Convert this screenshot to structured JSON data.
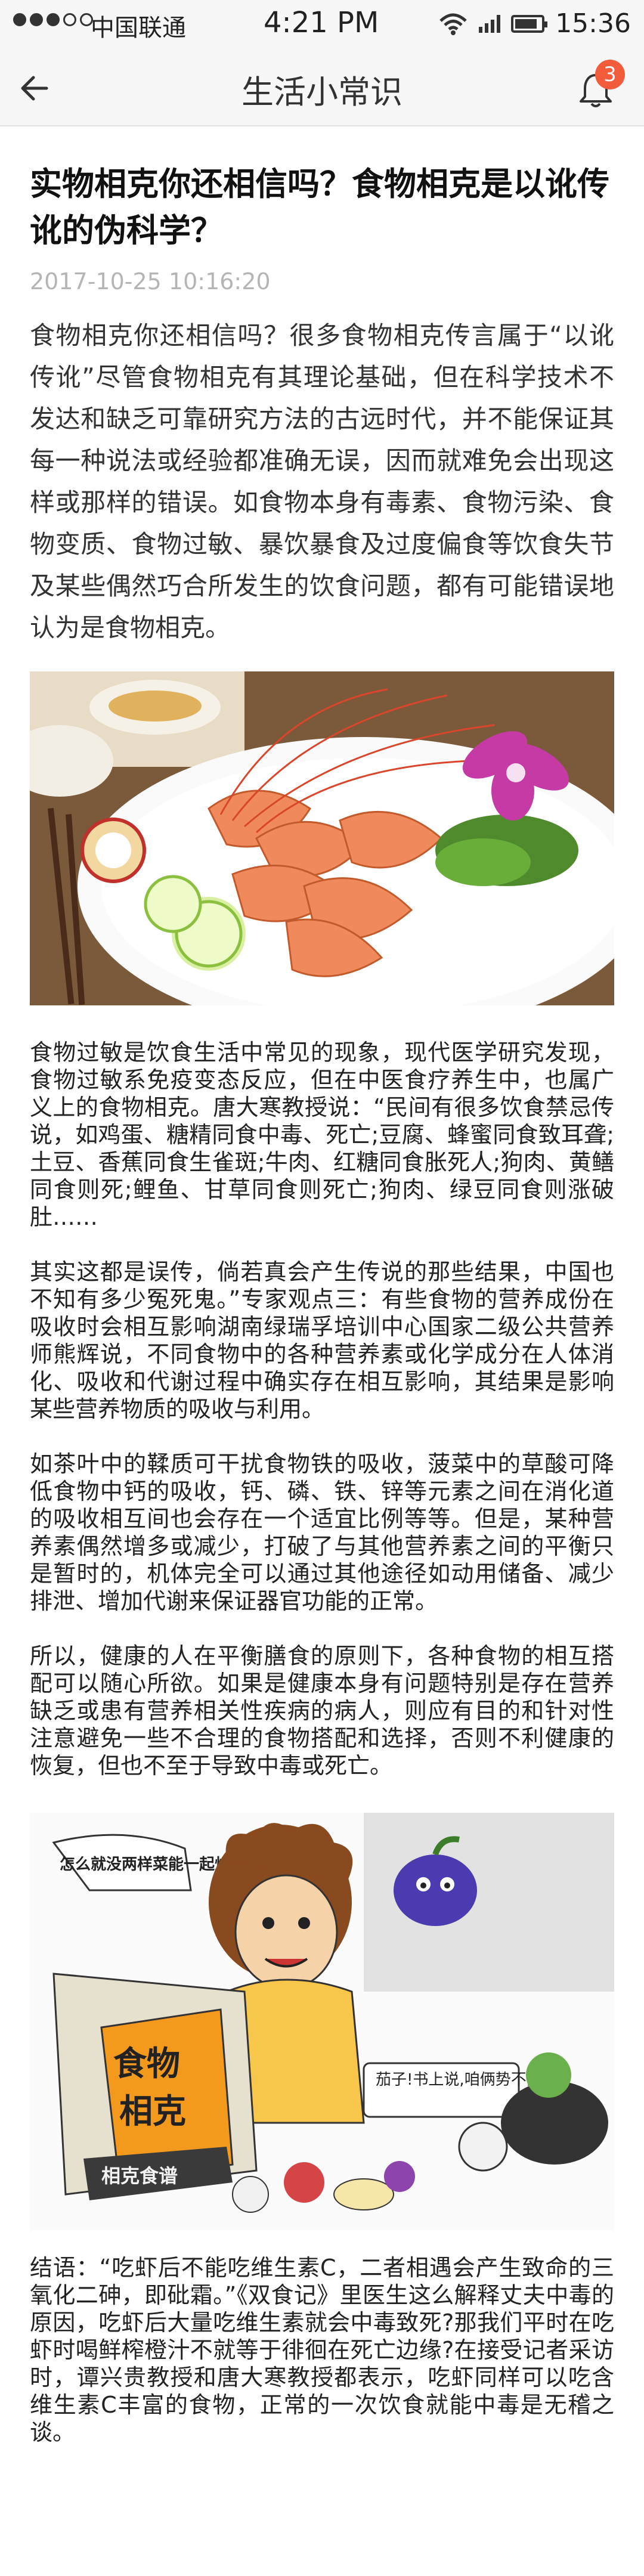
{
  "status_bar": {
    "carrier": "中国联通",
    "time_center": "4:21 PM",
    "time_right": "15:36"
  },
  "nav": {
    "title": "生活小常识",
    "badge_count": "3",
    "icons": {
      "back": "back-arrow-icon",
      "bell": "bell-icon"
    }
  },
  "article": {
    "title": "实物相克你还相信吗？食物相克是以讹传讹的伪科学？",
    "date": "2017-10-25  10:16:20",
    "intro": "食物相克你还相信吗？很多食物相克传言属于“以讹传讹”尽管食物相克有其理论基础，但在科学技术不发达和缺乏可靠研究方法的古远时代，并不能保证其每一种说法或经验都准确无误，因而就难免会出现这样或那样的错误。如食物本身有毒素、食物污染、食物变质、食物过敏、暴饮暴食及过度偏食等饮食失节及某些偶然巧合所发生的饮食问题，都有可能错误地认为是食物相克。",
    "para_2": "食物过敏是饮食生活中常见的现象，现代医学研究发现，食物过敏系免疫变态反应，但在中医食疗养生中，也属广义上的食物相克。唐大寒教授说：“民间有很多饮食禁忌传说，如鸡蛋、糖精同食中毒、死亡;豆腐、蜂蜜同食致耳聋;土豆、香蕉同食生雀斑;牛肉、红糖同食胀死人;狗肉、黄鳝同食则死;鲤鱼、甘草同食则死亡;狗肉、绿豆同食则涨破肚……",
    "para_3": "其实这都是误传，倘若真会产生传说的那些结果，中国也不知有多少冤死鬼。”专家观点三：有些食物的营养成份在吸收时会相互影响湖南绿瑞孚培训中心国家二级公共营养师熊辉说，不同食物中的各种营养素或化学成分在人体消化、吸收和代谢过程中确实存在相互影响，其结果是影响某些营养物质的吸收与利用。",
    "para_4": "如茶叶中的鞣质可干扰食物铁的吸收，菠菜中的草酸可降低食物中钙的吸收，钙、磷、铁、锌等元素之间在消化道的吸收相互间也会存在一个适宜比例等等。但是，某种营养素偶然增多或减少，打破了与其他营养素之间的平衡只是暂时的，机体完全可以通过其他途径如动用储备、减少排泄、增加代谢来保证器官功能的正常。",
    "para_5": "所以，健康的人在平衡膳食的原则下，各种食物的相互搭配可以随心所欲。如果是健康本身有问题特别是存在营养缺乏或患有营养相关性疾病的病人，则应有目的和针对性注意避免一些不合理的食物搭配和选择，否则不利健康的恢复，但也不至于导致中毒或死亡。",
    "para_6": "结语：“吃虾后不能吃维生素C，二者相遇会产生致命的三氧化二砷，即砒霜。”《双食记》里医生这么解释丈夫中毒的原因，吃虾后大量吃维生素就会中毒致死?那我们平时在吃虾时喝鲜榨橙汁不就等于徘徊在死亡边缘?在接受记者采访时，谭兴贵教授和唐大寒教授都表示，吃虾同样可以吃含维生素C丰富的食物，正常的一次饮食就能中毒是无稽之谈。"
  },
  "cartoon": {
    "speech_1": "怎么就没两样菜能一起炒啊！",
    "book_title": "食物相克",
    "book_spine": "相克食谱",
    "speech_2": "茄子!书上说,咱俩势不两立!"
  },
  "colors": {
    "badge": "#f25c3b",
    "date": "#b5b5b5",
    "nav_bg": "#f7f7f7"
  }
}
